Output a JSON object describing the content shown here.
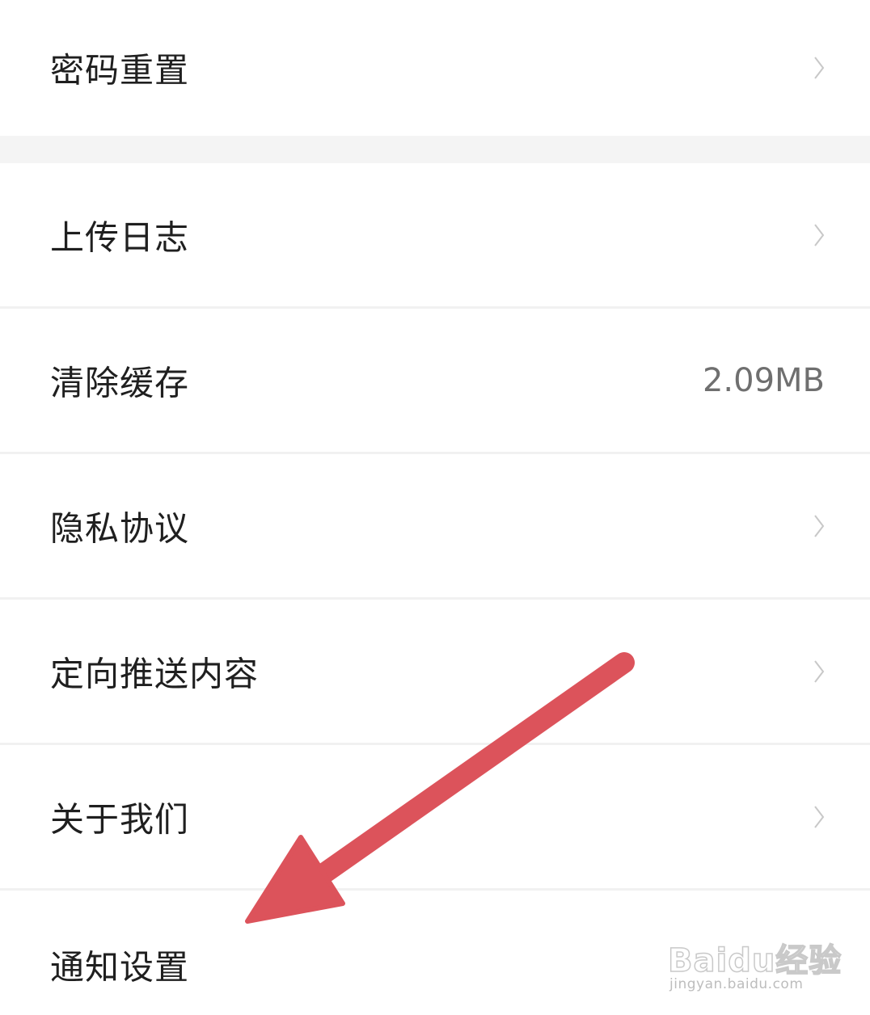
{
  "settings": {
    "items": [
      {
        "label": "密码重置",
        "value": "",
        "chevron": true
      },
      {
        "label": "上传日志",
        "value": "",
        "chevron": true
      },
      {
        "label": "清除缓存",
        "value": "2.09MB",
        "chevron": false
      },
      {
        "label": "隐私协议",
        "value": "",
        "chevron": true
      },
      {
        "label": "定向推送内容",
        "value": "",
        "chevron": true
      },
      {
        "label": "关于我们",
        "value": "",
        "chevron": true
      },
      {
        "label": "通知设置",
        "value": "",
        "chevron": true
      }
    ]
  },
  "annotation": {
    "arrow_color": "#dc535b",
    "icon": "arrow-pointing-icon"
  },
  "watermark": {
    "main": "Baidu经验",
    "sub": "jingyan.baidu.com"
  },
  "colors": {
    "text": "#1f1f1f",
    "secondary_text": "#6f6f6f",
    "chevron": "#c8c8c8",
    "divider": "#f1f1f1",
    "section_gap": "#f4f4f4"
  }
}
